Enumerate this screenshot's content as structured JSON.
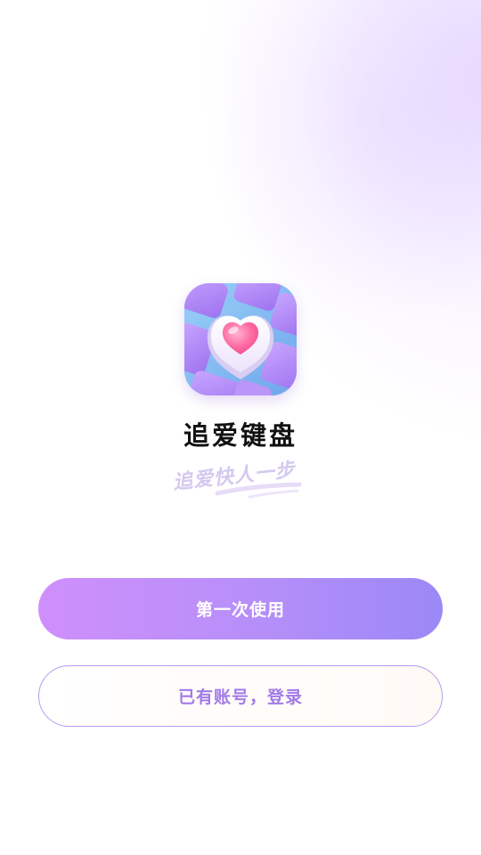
{
  "app": {
    "name": "追爱键盘",
    "slogan": "追爱快人一步",
    "icon": "heart-keycap-icon"
  },
  "actions": {
    "first_use_label": "第一次使用",
    "login_label": "已有账号，登录"
  },
  "colors": {
    "primary_gradient_start": "#cf8ffb",
    "primary_gradient_end": "#9b88f7",
    "secondary_border": "#b69af3",
    "secondary_text": "#a27ae8",
    "app_name_text": "#111111",
    "slogan_text": "#d4c9ef"
  }
}
